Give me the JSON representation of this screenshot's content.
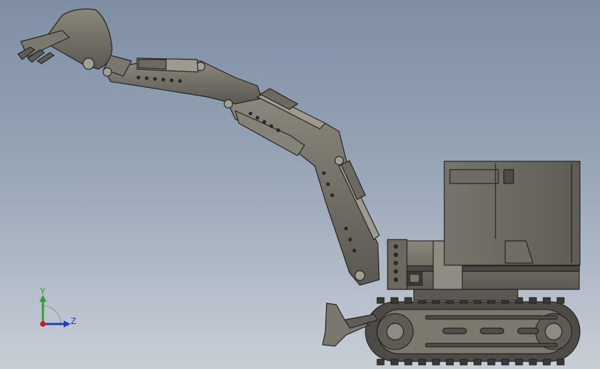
{
  "viewport": {
    "background_top": "#7f8ea3",
    "background_bottom": "#c8ced6"
  },
  "model": {
    "subject": "mini-excavator-assembly",
    "body_color": "#6e6c62",
    "edge_color": "#2b2b2b",
    "highlight_color": "#b9b6a6"
  },
  "triad": {
    "y_label": "Y",
    "z_label": "Z",
    "y_color": "#2e9e2e",
    "z_color": "#1e3cc8",
    "origin_color": "#c81e1e"
  }
}
